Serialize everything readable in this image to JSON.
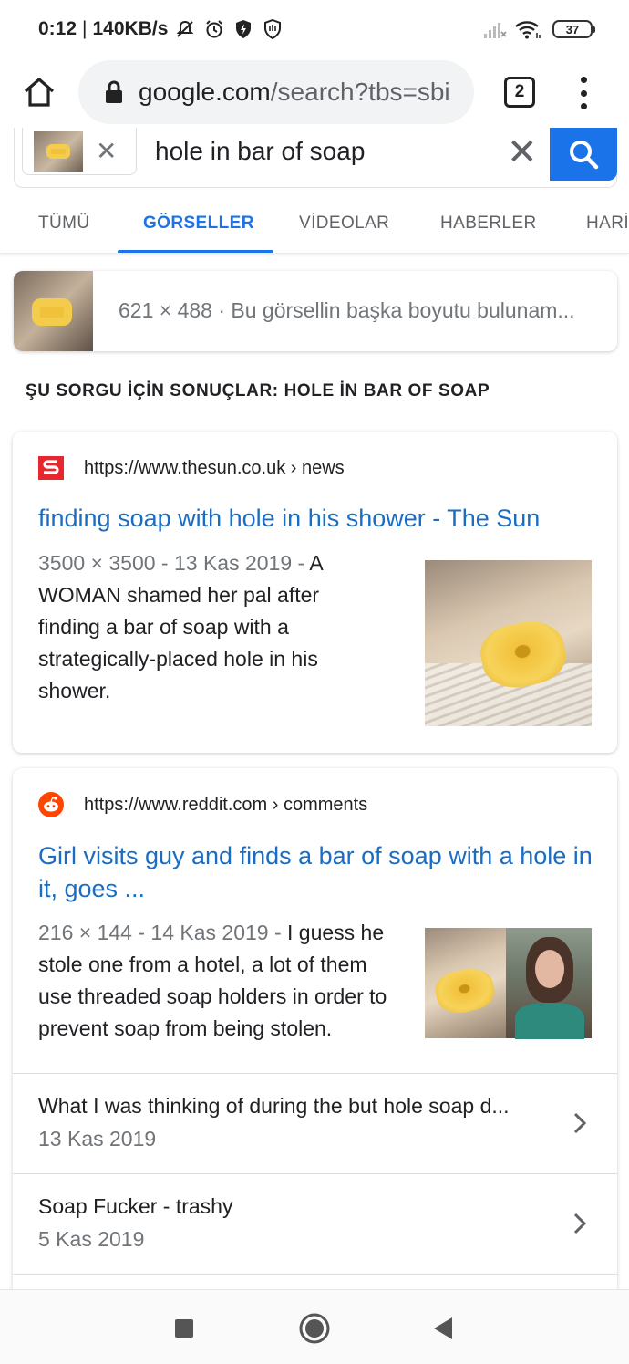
{
  "status_bar": {
    "time": "0:12",
    "speed": "140KB/s",
    "battery": "37"
  },
  "browser": {
    "url_host": "google.com",
    "url_path": "/search?tbs=sbi",
    "tab_count": "2"
  },
  "search": {
    "query": "hole in bar of soap"
  },
  "tabs": [
    {
      "label": "TÜMÜ"
    },
    {
      "label": "GÖRSELLER"
    },
    {
      "label": "VİDEOLAR"
    },
    {
      "label": "HABERLER"
    },
    {
      "label": "HARİ"
    }
  ],
  "image_info": {
    "text": "621 × 488 · Bu görsellin başka boyutu bulunam..."
  },
  "results_heading": "ŞU SORGU İÇİN SONUÇLAR: HOLE İN BAR OF SOAP",
  "results": [
    {
      "source": "https://www.thesun.co.uk › news",
      "title": "finding soap with hole in his shower - The Sun",
      "meta": "3500 × 3500 - 13 Kas 2019 - ",
      "snippet": "A WOMAN shamed her pal after finding a bar of soap with a strategically-placed hole in his shower."
    },
    {
      "source": "https://www.reddit.com › comments",
      "title": "Girl visits guy and finds a bar of soap with a hole in it, goes ...",
      "meta": "216 × 144 - 14 Kas 2019 - ",
      "snippet": "I guess he stole one from a hotel, a lot of them use threaded soap holders in order to prevent soap from being stolen.",
      "sub_results": [
        {
          "title": "What I was thinking of during the but hole soap d...",
          "date": "13 Kas 2019"
        },
        {
          "title": "Soap Fucker - trashy",
          "date": "5 Kas 2019"
        }
      ]
    }
  ],
  "colors": {
    "accent": "#1a73e8",
    "link": "#1a6dc3",
    "sun_red": "#e8262d",
    "reddit_orange": "#ff4500"
  }
}
